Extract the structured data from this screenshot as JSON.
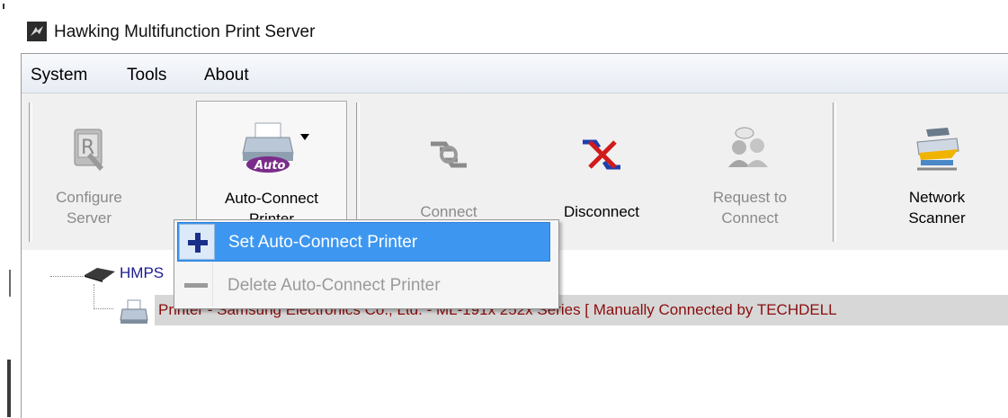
{
  "window": {
    "title": "Hawking Multifunction Print Server"
  },
  "menubar": {
    "items": [
      "System",
      "Tools",
      "About"
    ]
  },
  "toolbar": {
    "configure_label": "Configure\nServer",
    "autoconnect_label": "Auto-Connect\nPrinter",
    "autoconnect_badge": "Auto",
    "connect_label": "Connect",
    "disconnect_label": "Disconnect",
    "request_label": "Request to\nConnect",
    "scanner_label": "Network\nScanner"
  },
  "tree": {
    "root_label": "HMPS",
    "printer_label": "Printer - Samsung Electronics Co., Ltd. - ML-191x 252x Series [ Manually Connected by TECHDELL"
  },
  "popup_menu": {
    "items": [
      {
        "label": "Set Auto-Connect Printer",
        "icon": "plus-icon",
        "enabled": true,
        "highlighted": true
      },
      {
        "label": "Delete Auto-Connect Printer",
        "icon": "minus-icon",
        "enabled": false
      }
    ]
  },
  "colors": {
    "highlight": "#3d97f0",
    "tree_root_text": "#1b1b8f",
    "printer_text": "#8b0d0d",
    "disabled_text": "#8a8a8a"
  }
}
